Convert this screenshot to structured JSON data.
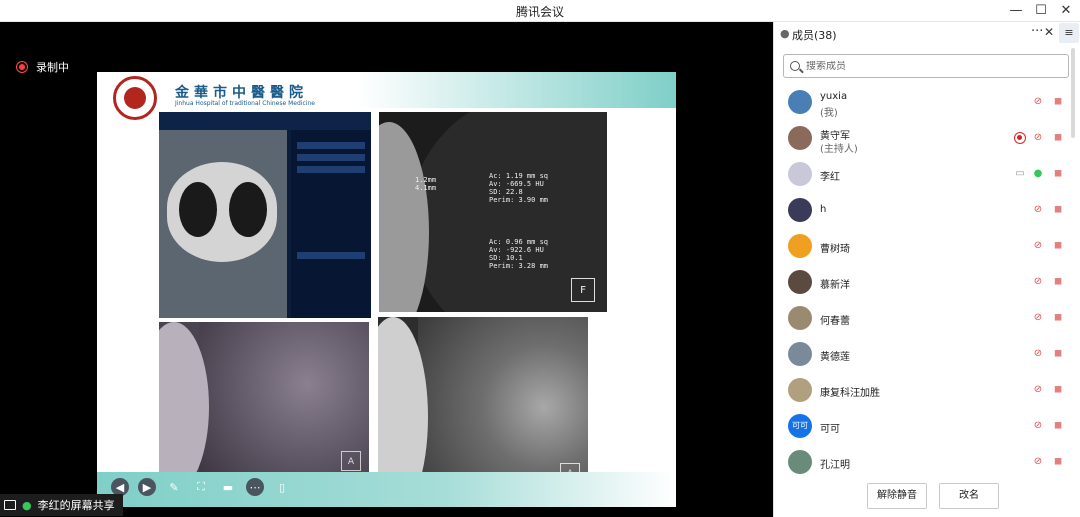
{
  "window": {
    "title": "腾讯会议",
    "minimize": "—",
    "maximize": "☐",
    "close": "✕"
  },
  "recording": {
    "label": "录制中"
  },
  "slide": {
    "hospital_name": "金華市中醫醫院",
    "hospital_name_en": "Jinhua Hospital of traditional Chinese Medicine",
    "panel2_text_top": "Ac: 1.19 mm sq\nAv: -669.5 HU\nSD: 22.8\nPerim: 3.90 mm",
    "panel2_text_bottom": "Ac: 0.96 mm sq\nAv: -922.6 HU\nSD: 10.1\nPerim: 3.28 mm",
    "panel2_text_left": "1.2mm\n4.1mm",
    "panel2_corner": "F",
    "panel3_corner": "A",
    "panel4_corner": "A"
  },
  "screen_share": {
    "label": "李红的屏幕共享"
  },
  "sidebar": {
    "members_title": "成员(38)",
    "more": "···",
    "close": "✕",
    "menu": "≡",
    "search_placeholder": "搜索成员",
    "members": [
      {
        "name": "yuxia",
        "role": "(我)",
        "avatar": "#4a7fb5",
        "rec": false,
        "screen": false,
        "mic_on": false
      },
      {
        "name": "黄守军",
        "role": "(主持人)",
        "avatar": "#8a6a5a",
        "rec": true,
        "screen": false,
        "mic_on": false
      },
      {
        "name": "李红",
        "role": "",
        "avatar": "#c8c8d8",
        "rec": false,
        "screen": true,
        "mic_on": true
      },
      {
        "name": "h",
        "role": "",
        "avatar": "#3a3a5a",
        "rec": false,
        "screen": false,
        "mic_on": false
      },
      {
        "name": "曹树琦",
        "role": "",
        "avatar": "#f0a020",
        "rec": false,
        "screen": false,
        "mic_on": false
      },
      {
        "name": "慕新洋",
        "role": "",
        "avatar": "#5a4a40",
        "rec": false,
        "screen": false,
        "mic_on": false
      },
      {
        "name": "何春蕾",
        "role": "",
        "avatar": "#9a8a70",
        "rec": false,
        "screen": false,
        "mic_on": false
      },
      {
        "name": "黄德莲",
        "role": "",
        "avatar": "#7a8a9a",
        "rec": false,
        "screen": false,
        "mic_on": false
      },
      {
        "name": "康复科汪加胜",
        "role": "",
        "avatar": "#b0a080",
        "rec": false,
        "screen": false,
        "mic_on": false
      },
      {
        "name": "可可",
        "role": "",
        "avatar_text": "可可",
        "avatar": "#1473e6",
        "rec": false,
        "screen": false,
        "mic_on": false
      },
      {
        "name": "孔江明",
        "role": "",
        "avatar": "#6a8a7a",
        "rec": false,
        "screen": false,
        "mic_on": false
      }
    ],
    "unmute_all_button": "解除静音",
    "rename_button": "改名"
  }
}
